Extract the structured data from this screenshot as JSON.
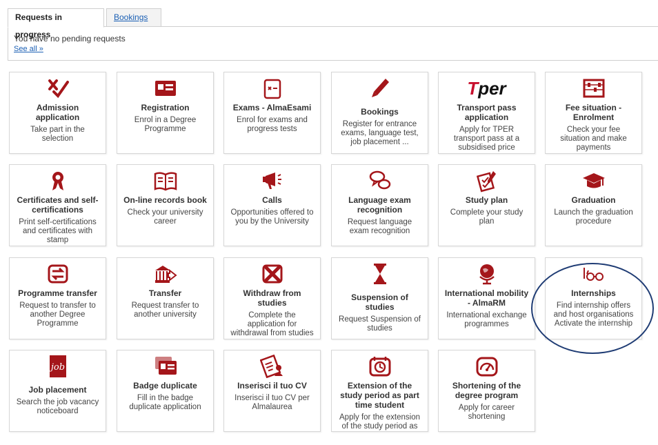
{
  "tabs": {
    "active": "Requests in progress",
    "inactive": "Bookings"
  },
  "requests": {
    "message": "You have no pending requests",
    "see_all": "See all »"
  },
  "tiles": [
    {
      "title": "Admission application",
      "desc": "Take part in the selection",
      "icon": "admission-icon"
    },
    {
      "title": "Registration",
      "desc": "Enrol in a Degree Programme",
      "icon": "registration-card-icon"
    },
    {
      "title": "Exams - AlmaEsami",
      "desc": "Enrol for exams and progress tests",
      "icon": "exam-paper-icon"
    },
    {
      "title": "Bookings",
      "desc": "Register for entrance exams, language test, job placement ...",
      "icon": "pen-icon"
    },
    {
      "title": "Transport pass application",
      "desc": "Apply for TPER transport pass at a subsidised price",
      "icon": "tper-logo",
      "logo_text": "per"
    },
    {
      "title": "Fee situation - Enrolment",
      "desc": "Check your fee situation and make payments",
      "icon": "abacus-icon"
    },
    {
      "title": "Certificates and self-certifications",
      "desc": "Print self-certifications and certificates with stamp",
      "icon": "rosette-icon"
    },
    {
      "title": "On-line records book",
      "desc": "Check your university career",
      "icon": "open-book-icon"
    },
    {
      "title": "Calls",
      "desc": "Opportunities offered to you by the University",
      "icon": "megaphone-icon"
    },
    {
      "title": "Language exam recognition",
      "desc": "Request language exam recognition",
      "icon": "speech-bubbles-icon"
    },
    {
      "title": "Study plan",
      "desc": "Complete your study plan",
      "icon": "checklist-icon"
    },
    {
      "title": "Graduation",
      "desc": "Launch the graduation procedure",
      "icon": "graduation-cap-icon"
    },
    {
      "title": "Programme transfer",
      "desc": "Request to transfer to another Degree Programme",
      "icon": "transfer-arrows-icon"
    },
    {
      "title": "Transfer",
      "desc": "Request transfer to another university",
      "icon": "building-arrow-icon"
    },
    {
      "title": "Withdraw from studies",
      "desc": "Complete the application for withdrawal from studies",
      "icon": "withdraw-x-icon"
    },
    {
      "title": "Suspension of studies",
      "desc": "Request Suspension of studies",
      "icon": "hourglass-icon"
    },
    {
      "title": "International mobility - AlmaRM",
      "desc": "International exchange programmes",
      "icon": "globe-icon"
    },
    {
      "title": "Internships",
      "desc": "Find internship offers and host organisations Activate the internship",
      "icon": "glasses-icon"
    },
    {
      "title": "Job placement",
      "desc": "Search the job vacancy noticeboard",
      "icon": "job-logo-icon"
    },
    {
      "title": "Badge duplicate",
      "desc": "Fill in the badge duplicate application",
      "icon": "badge-card-icon"
    },
    {
      "title": "Inserisci il tuo CV",
      "desc": "Inserisci il tuo CV per Almalaurea",
      "icon": "cv-document-icon"
    },
    {
      "title": "Extension of the study period as part time student",
      "desc": "Apply for the extension of the study period as",
      "icon": "clock-calendar-icon"
    },
    {
      "title": "Shortening of the degree program",
      "desc": "Apply for career shortening",
      "icon": "speedometer-icon"
    }
  ],
  "colors": {
    "icon_red": "#a4161a",
    "link_blue": "#1a5fb4",
    "circle_navy": "#1f3c74"
  }
}
